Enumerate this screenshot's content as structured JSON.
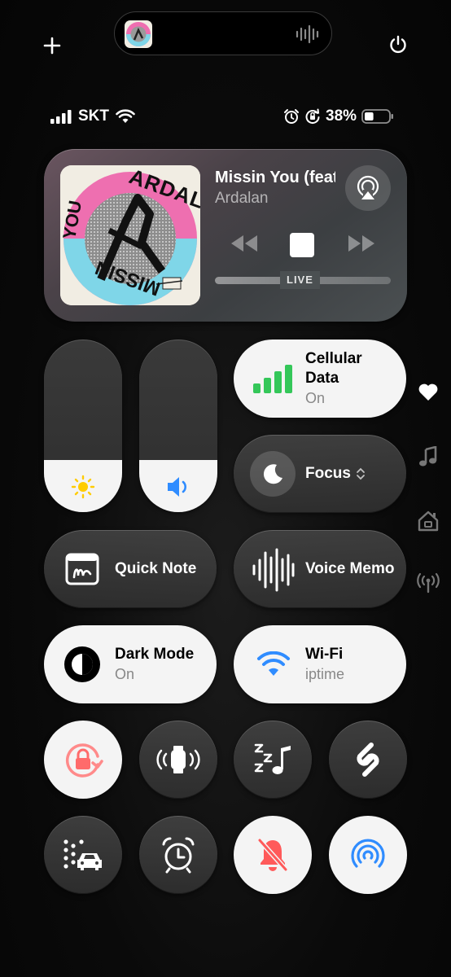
{
  "status": {
    "carrier": "SKT",
    "battery_percent": "38%",
    "battery_level": 0.38
  },
  "now_playing": {
    "title": "Missin You (feat",
    "artist": "Ardalan",
    "progress_label": "LIVE",
    "album_art_text": [
      "ARDALAN",
      "MISSIN",
      "YOU"
    ]
  },
  "sliders": {
    "brightness_level": 0.3,
    "volume_level": 0.3
  },
  "tiles": {
    "cellular": {
      "label_line1": "Cellular",
      "label_line2": "Data",
      "state": "On"
    },
    "focus": {
      "label": "Focus"
    },
    "quick_note": {
      "label": "Quick Note"
    },
    "voice_memo": {
      "label": "Voice Memo"
    },
    "dark_mode": {
      "label": "Dark Mode",
      "state": "On"
    },
    "wifi": {
      "label": "Wi-Fi",
      "network": "iptime"
    }
  },
  "colors": {
    "cellular_green": "#34c759",
    "wifi_blue": "#2f8cff",
    "lock_red": "#ff6b6b",
    "bell_red": "#ff5a5a",
    "brightness_yellow": "#ffcc00",
    "volume_blue": "#2f8cff"
  },
  "icons": [
    "plus-icon",
    "power-icon",
    "signal-icon",
    "wifi-icon",
    "alarm-icon",
    "rotation-lock-icon",
    "battery-icon",
    "airplay-icon",
    "rewind-icon",
    "stop-icon",
    "fast-forward-icon",
    "sun-icon",
    "speaker-icon",
    "cellular-bars-icon",
    "moon-icon",
    "updown-chevron-icon",
    "quick-note-icon",
    "waveform-icon",
    "dark-mode-icon",
    "wifi-icon",
    "orientation-lock-icon",
    "watch-ping-icon",
    "sleep-music-icon",
    "shazam-icon",
    "vehicle-motion-icon",
    "alarm-clock-icon",
    "silent-bell-icon",
    "airdrop-icon",
    "heart-icon",
    "music-note-icon",
    "home-icon",
    "antenna-icon"
  ]
}
